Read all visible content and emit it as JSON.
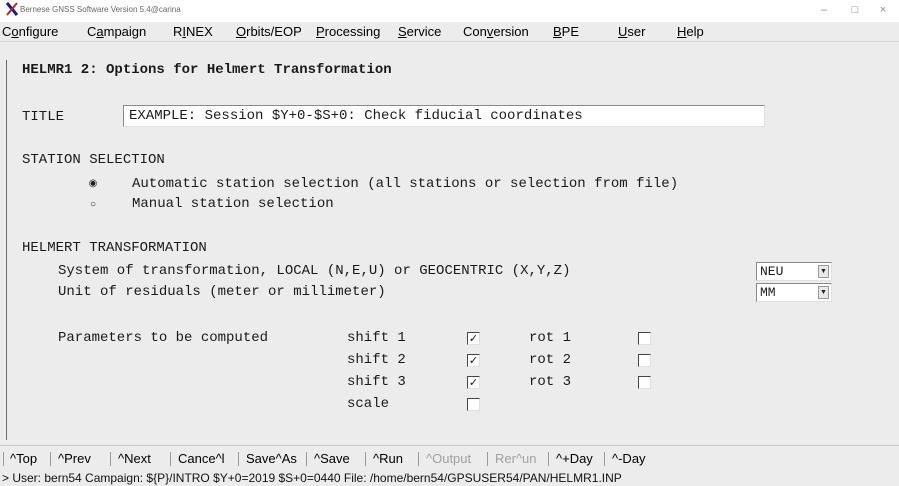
{
  "window": {
    "title": "Bernese GNSS Software Version 5.4@carina",
    "controls": {
      "minimize": "–",
      "maximize": "□",
      "close": "×"
    }
  },
  "menubar": {
    "items": [
      {
        "label": "Configure"
      },
      {
        "label": "Campaign"
      },
      {
        "label": "RINEX"
      },
      {
        "label": "Orbits/EOP"
      },
      {
        "label": "Processing"
      },
      {
        "label": "Service"
      },
      {
        "label": "Conversion"
      },
      {
        "label": "BPE"
      },
      {
        "label": "User"
      },
      {
        "label": "Help"
      }
    ]
  },
  "panel": {
    "heading": "HELMR1 2: Options for Helmert Transformation",
    "title_label": "TITLE",
    "title_value": "EXAMPLE: Session $Y+0-$S+0: Check fiducial coordinates",
    "station_selection": {
      "header": "STATION SELECTION",
      "options": [
        {
          "label": "Automatic station selection (all stations or selection from file)",
          "selected": true
        },
        {
          "label": "Manual station selection",
          "selected": false
        }
      ]
    },
    "helmert": {
      "header": "HELMERT TRANSFORMATION",
      "system_label": "System of transformation, LOCAL (N,E,U) or GEOCENTRIC (X,Y,Z)",
      "system_value": "NEU",
      "unit_label": "Unit of residuals (meter or millimeter)",
      "unit_value": "MM"
    },
    "parameters": {
      "label": "Parameters to be computed",
      "shift_1": {
        "label": "shift 1",
        "checked": true
      },
      "shift_2": {
        "label": "shift 2",
        "checked": true
      },
      "shift_3": {
        "label": "shift 3",
        "checked": true
      },
      "scale": {
        "label": "scale",
        "checked": false
      },
      "rot_1": {
        "label": "rot 1",
        "checked": false
      },
      "rot_2": {
        "label": "rot 2",
        "checked": false
      },
      "rot_3": {
        "label": "rot 3",
        "checked": false
      }
    }
  },
  "toolbar": {
    "top": "^Top",
    "prev": "^Prev",
    "next": "^Next",
    "cancel": "Cance^l",
    "save_as": "Save^As",
    "save": "^Save",
    "run": "^Run",
    "output": "^Output",
    "rerun": "Rer^un",
    "plus_day": "^+Day",
    "minus_day": "^-Day"
  },
  "statusbar": {
    "text": "> User: bern54  Campaign: ${P}/INTRO  $Y+0=2019  $S+0=0440  File: /home/bern54/GPSUSER54/PAN/HELMR1.INP"
  },
  "colors": {
    "background": "#ececec",
    "disabled_text": "#a0a0a0",
    "x_logo_blue": "#1a1a8c",
    "x_logo_red": "#c02020"
  }
}
